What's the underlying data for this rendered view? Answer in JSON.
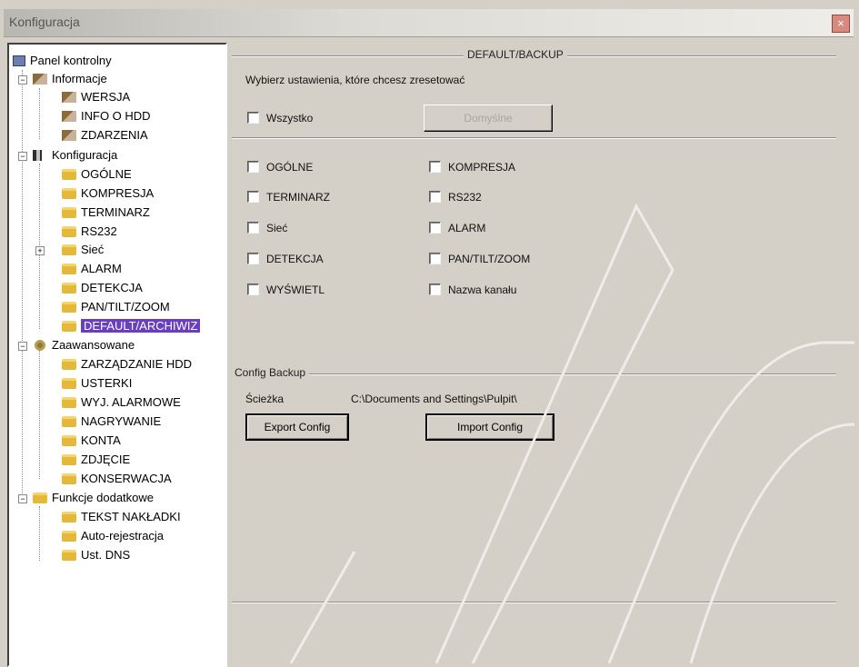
{
  "window": {
    "title": "Konfiguracja",
    "close_glyph": "×"
  },
  "tree": {
    "root": "Panel kontrolny",
    "informacje": {
      "label": "Informacje",
      "items": [
        "WERSJA",
        "INFO O HDD",
        "ZDARZENIA"
      ]
    },
    "konfiguracja": {
      "label": "Konfiguracja",
      "items": [
        "OGÓLNE",
        "KOMPRESJA",
        "TERMINARZ",
        "RS232",
        "Sieć",
        "ALARM",
        "DETEKCJA",
        "PAN/TILT/ZOOM",
        "DEFAULT/ARCHIWIZ"
      ]
    },
    "zaawansowane": {
      "label": "Zaawansowane",
      "items": [
        "ZARZĄDZANIE HDD",
        "USTERKI",
        "WYJ. ALARMOWE",
        "NAGRYWANIE",
        "KONTA",
        "ZDJĘCIE",
        "KONSERWACJA"
      ]
    },
    "funkcje": {
      "label": "Funkcje dodatkowe",
      "items": [
        "TEKST NAKŁADKI",
        "Auto-rejestracja",
        "Ust. DNS"
      ]
    },
    "selected": "DEFAULT/ARCHIWIZ"
  },
  "default_backup": {
    "title": "DEFAULT/BACKUP",
    "instruction": "Wybierz ustawienia, które chcesz zresetować",
    "all_label": "Wszystko",
    "default_button": "Domyślne",
    "left_options": [
      "OGÓLNE",
      "TERMINARZ",
      "Sieć",
      "DETEKCJA",
      "WYŚWIETL"
    ],
    "right_options": [
      "KOMPRESJA",
      "RS232",
      "ALARM",
      "PAN/TILT/ZOOM",
      "Nazwa kanału"
    ]
  },
  "config_backup": {
    "title": "Config Backup",
    "path_label": "Ścieżka",
    "path_value": "C:\\Documents and Settings\\Pulpit\\",
    "export_button": "Export Config",
    "import_button": "Import Config"
  }
}
